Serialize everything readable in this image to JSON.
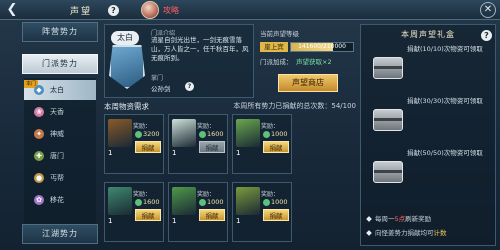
{
  "topbar": {
    "title": "声望",
    "player_name": "攻略"
  },
  "sidebar": {
    "tabs": [
      {
        "label": "阵营势力"
      },
      {
        "label": "门派势力"
      },
      {
        "label": "江湖势力"
      }
    ],
    "my_school_badge": "本门",
    "schools": [
      {
        "label": "太白",
        "icon": "taibai-icon",
        "color": "#4e8fc0"
      },
      {
        "label": "天香",
        "icon": "tianxiang-icon",
        "color": "#d77aa4"
      },
      {
        "label": "神威",
        "icon": "shenwei-icon",
        "color": "#c47a4a"
      },
      {
        "label": "唐门",
        "icon": "tangmen-icon",
        "color": "#7a9c48"
      },
      {
        "label": "丐帮",
        "icon": "gaibang-icon",
        "color": "#c59a4c"
      },
      {
        "label": "移花",
        "icon": "yihua-icon",
        "color": "#a277c8"
      }
    ]
  },
  "school": {
    "name": "太白",
    "intro_label": "门派介绍",
    "intro_text": "流星自剑光出世，一剑无痕雪落山，万人皆之一，任千秋百年，风无痕所到。",
    "gate_label": "掌门",
    "gate_value": "公孙剑"
  },
  "prestige": {
    "title": "当前声望等级",
    "rank": "崖上宾",
    "progress_text": "141600/210000",
    "progress": 0.674,
    "bonus_label": "门派加成：",
    "bonus_value": "声望获取×2",
    "shop_label": "声望商店"
  },
  "demand": {
    "title": "本周物资需求",
    "total": "本周所有势力已捐献的总次数：54/100",
    "cards": [
      {
        "count": "1",
        "reward_label": "奖励：",
        "reward_value": "3200",
        "button": "捐献",
        "disabled": false,
        "item_color": "#8a5a2a"
      },
      {
        "count": "1",
        "reward_label": "奖励：",
        "reward_value": "1600",
        "button": "捐献",
        "disabled": true,
        "item_color": "#cfe0d8"
      },
      {
        "count": "1",
        "reward_label": "奖励：",
        "reward_value": "1000",
        "button": "捐献",
        "disabled": false,
        "item_color": "#6aa84f"
      },
      {
        "count": "1",
        "reward_label": "奖励：",
        "reward_value": "1600",
        "button": "捐献",
        "disabled": false,
        "item_color": "#3f8a6f"
      },
      {
        "count": "1",
        "reward_label": "奖励：",
        "reward_value": "1000",
        "button": "捐献",
        "disabled": false,
        "item_color": "#4f9a4a"
      },
      {
        "count": "1",
        "reward_label": "奖励：",
        "reward_value": "1000",
        "button": "捐献",
        "disabled": false,
        "item_color": "#7c9a3e"
      }
    ]
  },
  "weekly_rewards": {
    "title": "本周声望礼盒",
    "rows": [
      {
        "text": "捐献(10/10)次物资可领取"
      },
      {
        "text": "捐献(30/30)次物资可领取"
      },
      {
        "text": "捐献(50/50)次物资可领取"
      }
    ],
    "note1_pre": "每周一",
    "note1_highlight": "5点",
    "note1_post": "刷新奖励",
    "note2_pre": "向怪姜势力捐献均可",
    "note2_highlight": "计数"
  },
  "colors": {
    "accent_gold": "#e0b84a",
    "player_name": "#ff5e5e"
  }
}
